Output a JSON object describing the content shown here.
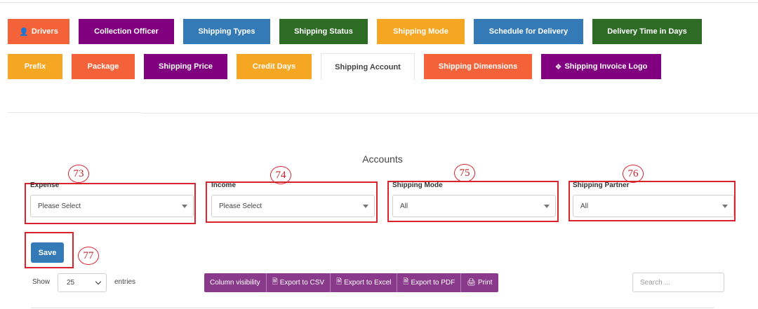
{
  "tabs_row1": [
    {
      "label": "Drivers",
      "color": "#f4623a",
      "icon": "user-icon",
      "glyph": "👤",
      "width": 88
    },
    {
      "label": "Collection Officer",
      "color": "#800080",
      "width": 136
    },
    {
      "label": "Shipping Types",
      "color": "#337ab7",
      "width": 124
    },
    {
      "label": "Shipping Status",
      "color": "#2e6b25",
      "width": 126
    },
    {
      "label": "Shipping Mode",
      "color": "#f5a623",
      "width": 125
    },
    {
      "label": "Schedule for Delivery",
      "color": "#337ab7",
      "width": 156
    },
    {
      "label": "Delivery Time in Days",
      "color": "#2e6b25",
      "width": 156
    }
  ],
  "tabs_row2": [
    {
      "label": "Prefix",
      "color": "#f5a623",
      "width": 78
    },
    {
      "label": "Package",
      "color": "#f4623a",
      "width": 90
    },
    {
      "label": "Shipping Price",
      "color": "#800080",
      "width": 119
    },
    {
      "label": "Credit Days",
      "color": "#f5a623",
      "width": 107
    },
    {
      "label": "Shipping Account",
      "color": "#ffffff",
      "active": true,
      "width": 134
    },
    {
      "label": "Shipping Dimensions",
      "color": "#f4623a",
      "width": 154
    },
    {
      "label": "Shipping Invoice Logo",
      "color": "#800080",
      "icon": "cubes-icon",
      "glyph": "❖",
      "width": 171
    }
  ],
  "page": {
    "title": "Accounts"
  },
  "fields": [
    {
      "label": "Expense",
      "value": "Please Select",
      "marker": "73"
    },
    {
      "label": "Income",
      "value": "Please Select",
      "marker": "74"
    },
    {
      "label": "Shipping Mode",
      "value": "All",
      "marker": "75"
    },
    {
      "label": "Shipping Partner",
      "value": "All",
      "marker": "76"
    }
  ],
  "save": {
    "label": "Save",
    "marker": "77"
  },
  "table_controls": {
    "show_label": "Show",
    "length_value": "25",
    "entries_label": "entries",
    "buttons": [
      {
        "label": "Column visibility",
        "icon": ""
      },
      {
        "label": "Export to CSV",
        "icon": "file-icon",
        "glyph": "🗎"
      },
      {
        "label": "Export to Excel",
        "icon": "file-excel-icon",
        "glyph": "🗎"
      },
      {
        "label": "Export to PDF",
        "icon": "file-pdf-icon",
        "glyph": "🗎"
      },
      {
        "label": "Print",
        "icon": "print-icon",
        "glyph": "🖨"
      }
    ],
    "search_placeholder": "Search ..."
  },
  "colors": {
    "annotation_red": "#d9232e",
    "primary": "#337ab7",
    "export_purple": "#8a3a8a"
  }
}
